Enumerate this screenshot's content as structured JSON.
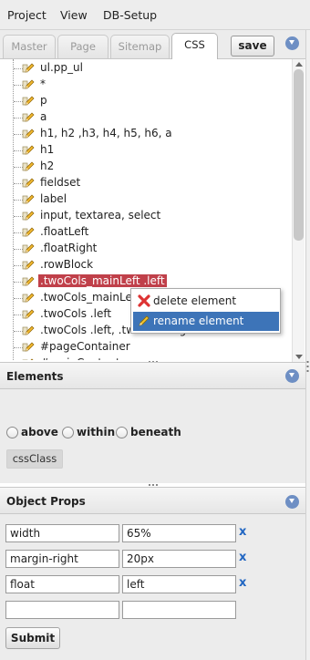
{
  "menu": [
    "Project",
    "View",
    "DB-Setup"
  ],
  "tabs": [
    {
      "label": "Master",
      "active": false
    },
    {
      "label": "Page",
      "active": false
    },
    {
      "label": "Sitemap",
      "active": false
    },
    {
      "label": "CSS",
      "active": true
    }
  ],
  "toolbar": {
    "save_label": "save"
  },
  "tree": {
    "items": [
      "ul.pp_ul",
      "*",
      "p",
      "a",
      "h1, h2 ,h3, h4, h5, h6, a",
      "h1",
      "h2",
      "fieldset",
      "label",
      "input, textarea, select",
      ".floatLeft",
      ".floatRight",
      ".rowBlock",
      ".twoCols_mainLeft .left",
      ".twoCols_mainLeft",
      ".twoCols .left",
      ".twoCols .left, .twoCols .right",
      "#pageContainer",
      "#mainContent",
      "..."
    ],
    "selected_index": 13
  },
  "context_menu": {
    "items": [
      {
        "label": "delete element",
        "icon": "red-x-icon"
      },
      {
        "label": "rename element",
        "icon": "pencil-icon"
      }
    ],
    "hover_index": 1
  },
  "elements_panel": {
    "title": "Elements",
    "positions": [
      "above",
      "within",
      "beneath"
    ],
    "css_class_label": "cssClass"
  },
  "object_props": {
    "title": "Object Props",
    "rows": [
      {
        "name": "width",
        "value": "65%",
        "remove": "x"
      },
      {
        "name": "margin-right",
        "value": "20px",
        "remove": "x"
      },
      {
        "name": "float",
        "value": "left",
        "remove": "x"
      },
      {
        "name": "",
        "value": "",
        "remove": ""
      }
    ],
    "submit_label": "Submit"
  },
  "colors": {
    "accent": "#6e8fc4",
    "selection": "#c0404a",
    "menu_hover": "#3d74b8",
    "remove_link": "#2166c2"
  }
}
